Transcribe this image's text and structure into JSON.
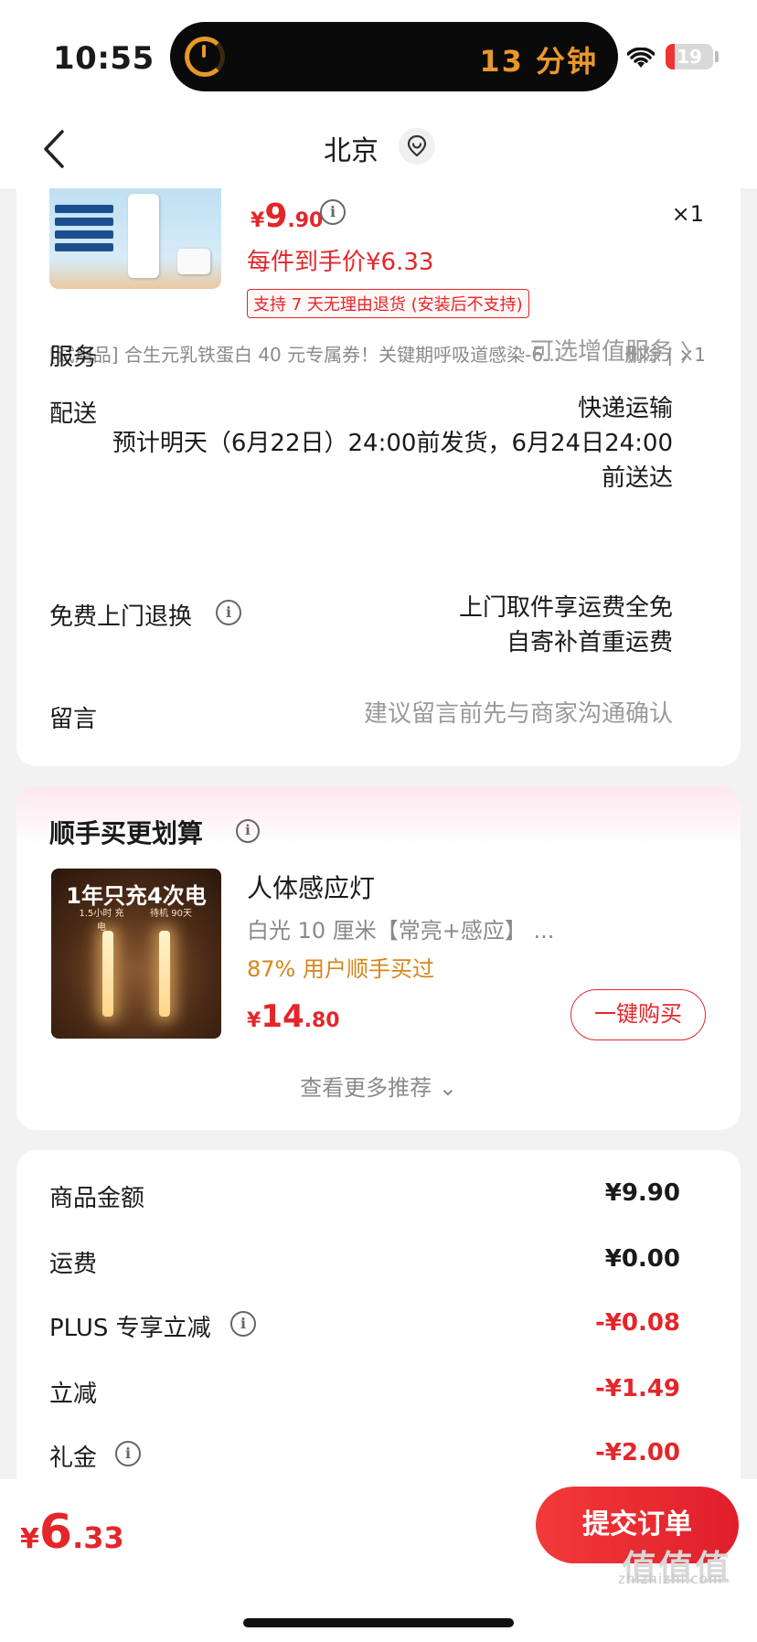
{
  "status_bar": {
    "time": "10:55",
    "activity_text": "13 分钟",
    "battery": "19",
    "battery_level": 0.19
  },
  "nav": {
    "title": "北京"
  },
  "product": {
    "price": {
      "symbol": "¥",
      "int": "9",
      "dec": ".90"
    },
    "quantity": "×1",
    "per_item_price": "每件到手价¥6.33",
    "return_policy": "支持 7 天无理由退货 (安装后不支持)"
  },
  "gift": {
    "text": "[试用品] 合生元乳铁蛋白 40 元专属券！关键期呼吸道感染-6...",
    "actions": "删除 | ×1"
  },
  "rows": {
    "service": {
      "label": "服务",
      "value": "可选增值服务",
      "chevron": "〉"
    },
    "delivery": {
      "label": "配送",
      "method": "快递运输",
      "estimate_line1": "预计明天（6月22日）24:00前发货，6月24日24:00",
      "estimate_line2": "前送达"
    },
    "return": {
      "label": "免费上门退换",
      "value_line1": "上门取件享运费全免",
      "value_line2": "自寄补首重运费"
    },
    "message": {
      "label": "留言",
      "placeholder": "建议留言前先与商家沟通确认"
    }
  },
  "recommend": {
    "title": "顺手买更划算",
    "image_headline": "1年只充4次电",
    "image_tag_left": "1.5小时 充电",
    "image_tag_right": "待机 90天",
    "name": "人体感应灯",
    "spec": "白光 10 厘米【常亮+感应】 ...",
    "social_proof": "87% 用户顺手买过",
    "price": {
      "symbol": "¥",
      "int": "14",
      "dec": ".80"
    },
    "buy_button": "一键购买",
    "more": "查看更多推荐 ⌄"
  },
  "summary": [
    {
      "label": "商品金额",
      "value": "¥9.90",
      "red": false,
      "info": false
    },
    {
      "label": "运费",
      "value": "¥0.00",
      "red": false,
      "info": false
    },
    {
      "label": "PLUS 专享立减",
      "value": "-¥0.08",
      "red": true,
      "info": true
    },
    {
      "label": "立减",
      "value": "-¥1.49",
      "red": true,
      "info": false
    },
    {
      "label": "礼金",
      "value": "-¥2.00",
      "red": true,
      "info": true
    }
  ],
  "bottom": {
    "total": {
      "symbol": "¥",
      "int": "6",
      "dec": ".33"
    },
    "submit": "提交订单",
    "watermark": "zhizhizhi.com",
    "watermark_logo": "值值值"
  },
  "colors": {
    "accent_red": "#e4262a",
    "accent_orange": "#d6861c",
    "island_orange": "#e8982b"
  }
}
